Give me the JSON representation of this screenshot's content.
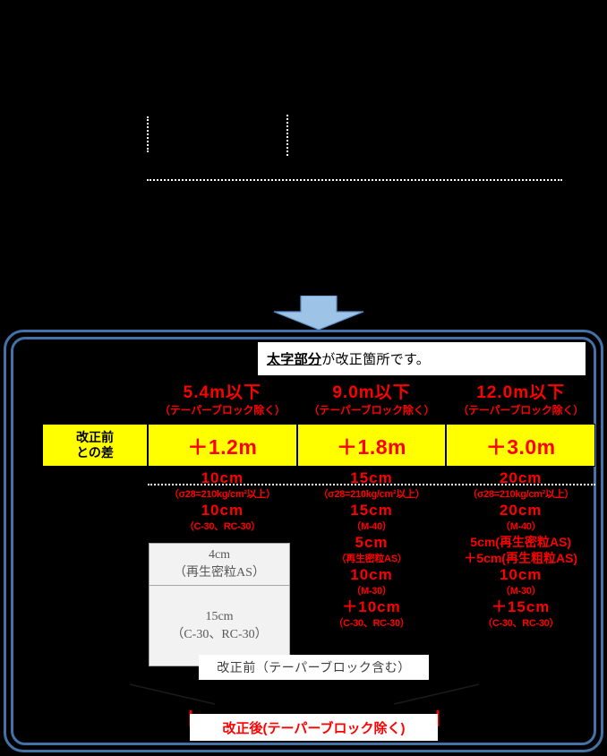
{
  "meta": {
    "accent_blue": "#4472A8",
    "arrow_blue": "#9DC3E6",
    "highlight_yellow": "#FFFF00",
    "emphasis_red": "#FF0000",
    "panel_grey": "#F2F2F2",
    "background": "#000000"
  },
  "note": {
    "emphasis": "太字部分",
    "rest": "が改正箇所です。"
  },
  "columns": [
    {
      "title": "5.4m以下",
      "subtitle": "（テーパーブロック除く）",
      "diff": "＋1.2m",
      "layers": [
        {
          "thickness": "10cm",
          "spec": "（σ28=210kg/cm²以上）"
        },
        {
          "thickness": "10cm",
          "spec": "（C-30、RC-30）"
        }
      ],
      "grey_boxes": [
        {
          "thickness": "4cm",
          "spec": "（再生密粒AS）"
        },
        {
          "thickness": "15cm",
          "spec": "（C-30、RC-30）"
        }
      ]
    },
    {
      "title": "9.0m以下",
      "subtitle": "（テーパーブロック除く）",
      "diff": "＋1.8m",
      "layers": [
        {
          "thickness": "15cm",
          "spec": "（σ28=210kg/cm²以上）"
        },
        {
          "thickness": "15cm",
          "spec": "（M-40）"
        },
        {
          "thickness": "5cm",
          "spec": "（再生密粒AS）"
        },
        {
          "thickness": "10cm",
          "spec": "（M-30）"
        },
        {
          "thickness": "＋10cm",
          "spec": "（C-30、RC-30）"
        }
      ],
      "grey_boxes": []
    },
    {
      "title": "12.0m以下",
      "subtitle": "（テーパーブロック除く）",
      "diff": "＋3.0m",
      "layers": [
        {
          "thickness": "20cm",
          "spec": "（σ28=210kg/cm²以上）"
        },
        {
          "thickness": "20cm",
          "spec": "（M-40）"
        },
        {
          "thickness": "5cm(再生密粒AS)",
          "spec": "＋5cm(再生粗粒AS)"
        },
        {
          "thickness": "10cm",
          "spec": "（M-30）"
        },
        {
          "thickness": "＋15cm",
          "spec": "（C-30、RC-30）"
        }
      ],
      "grey_boxes": []
    }
  ],
  "diff_row": {
    "label_line1": "改正前",
    "label_line2": "との差"
  },
  "dimensions": {
    "before": "改正前（テーパーブロック含む）",
    "after": "改正後(テーパーブロック除く)"
  }
}
